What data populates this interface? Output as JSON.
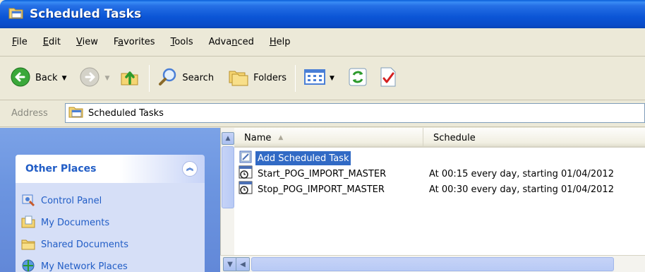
{
  "window": {
    "title": "Scheduled Tasks"
  },
  "menu": [
    {
      "label": "File",
      "mnemonic": "F",
      "rest": "ile"
    },
    {
      "label": "Edit",
      "mnemonic": "E",
      "rest": "dit"
    },
    {
      "label": "View",
      "mnemonic": "V",
      "rest": "iew"
    },
    {
      "label": "Favorites",
      "pre": "F",
      "mnemonic": "a",
      "rest": "vorites"
    },
    {
      "label": "Tools",
      "mnemonic": "T",
      "rest": "ools"
    },
    {
      "label": "Advanced",
      "pre": "Adva",
      "mnemonic": "n",
      "rest": "ced"
    },
    {
      "label": "Help",
      "mnemonic": "H",
      "rest": "elp"
    }
  ],
  "toolbar": {
    "back_label": "Back",
    "search_label": "Search",
    "folders_label": "Folders"
  },
  "address": {
    "label": "Address",
    "value": "Scheduled Tasks"
  },
  "other_places": {
    "title": "Other Places",
    "links": [
      {
        "label": "Control Panel",
        "icon": "control-panel-icon"
      },
      {
        "label": "My Documents",
        "icon": "my-documents-icon"
      },
      {
        "label": "Shared Documents",
        "icon": "folder-icon"
      },
      {
        "label": "My Network Places",
        "icon": "network-places-icon"
      }
    ]
  },
  "columns": {
    "name": "Name",
    "schedule": "Schedule"
  },
  "rows": [
    {
      "name": "Add Scheduled Task",
      "schedule": "",
      "selected": true,
      "icon": "add-task-icon"
    },
    {
      "name": "Start_POG_IMPORT_MASTER",
      "schedule": "At 00:15 every day, starting 01/04/2012",
      "selected": false,
      "icon": "scheduled-task-icon"
    },
    {
      "name": "Stop_POG_IMPORT_MASTER",
      "schedule": "At 00:30 every day, starting 01/04/2012",
      "selected": false,
      "icon": "scheduled-task-icon"
    }
  ],
  "colors": {
    "titlebar": "#0a55d6",
    "selection": "#316ac5",
    "task_pane": "#6c95e0",
    "link": "#215dc6"
  }
}
